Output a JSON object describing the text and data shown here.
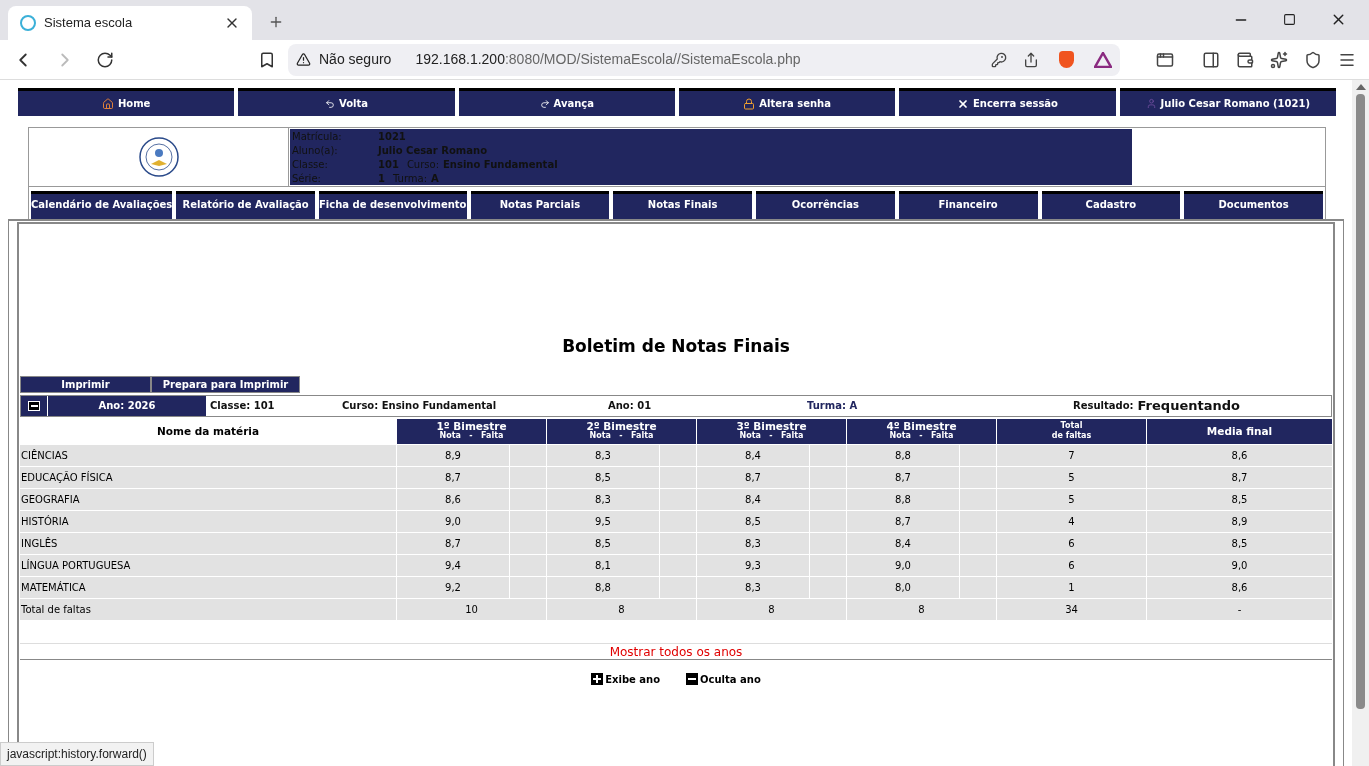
{
  "browser": {
    "tab_title": "Sistema escola",
    "security": "Não seguro",
    "url_host": "192.168.1.200",
    "url_path": ":8080/MOD/SistemaEscola//SistemaEscola.php"
  },
  "top_nav": [
    {
      "label": "Home",
      "kind": "home"
    },
    {
      "label": "Volta",
      "kind": "back"
    },
    {
      "label": "Avança",
      "kind": "forward"
    },
    {
      "label": "Altera senha",
      "kind": "lock"
    },
    {
      "label": "Encerra sessão",
      "kind": "close"
    },
    {
      "label": "Julio Cesar Romano (1021)",
      "kind": "user"
    }
  ],
  "student": [
    {
      "label": "Matrícula:",
      "value": "1021"
    },
    {
      "label": "Aluno(a):",
      "value": "Julio Cesar Romano"
    },
    {
      "label": "Classe:",
      "value": "101",
      "extra_label": "Curso:",
      "extra_value": "Ensino Fundamental"
    },
    {
      "label": "Série:",
      "value": "1",
      "extra_label": "Turma:",
      "extra_value": "A"
    }
  ],
  "tabs": [
    "Calendário de Avaliações",
    "Relatório de Avaliação",
    "Ficha de desenvolvimento",
    "Notas Parciais",
    "Notas Finais",
    "Ocorrências",
    "Financeiro",
    "Cadastro",
    "Documentos"
  ],
  "page_title": "Boletim de Notas Finais",
  "print_buttons": [
    "Imprimir",
    "Prepara para Imprimir"
  ],
  "year_bar": {
    "year": "Ano: 2026",
    "classe": "Classe: 101",
    "curso": "Curso: Ensino Fundamental",
    "ano": "Ano: 01",
    "turma": "Turma: A",
    "result_label": "Resultado:",
    "result_value": "Frequentando"
  },
  "table": {
    "columns": [
      {
        "title": "Nome da matéria",
        "kind": "name"
      },
      {
        "title": "1º Bimestre",
        "subtitle": "Nota   -   Falta",
        "kind": "bim"
      },
      {
        "title": "2º Bimestre",
        "subtitle": "Nota   -   Falta",
        "kind": "bim"
      },
      {
        "title": "3º Bimestre",
        "subtitle": "Nota   -   Falta",
        "kind": "bim"
      },
      {
        "title": "4º Bimestre",
        "subtitle": "Nota   -   Falta",
        "kind": "bim"
      },
      {
        "title": "Total",
        "subtitle": "de faltas",
        "kind": "small"
      },
      {
        "title": "Media final",
        "kind": "plain"
      }
    ],
    "rows": [
      {
        "subject": "CIÊNCIAS",
        "grades": [
          "8,9",
          "8,3",
          "8,4",
          "8,8"
        ],
        "total": "7",
        "media": "8,6"
      },
      {
        "subject": "EDUCAÇÃO FÍSICA",
        "grades": [
          "8,7",
          "8,5",
          "8,7",
          "8,7"
        ],
        "total": "5",
        "media": "8,7"
      },
      {
        "subject": "GEOGRAFIA",
        "grades": [
          "8,6",
          "8,3",
          "8,4",
          "8,8"
        ],
        "total": "5",
        "media": "8,5"
      },
      {
        "subject": "HISTÓRIA",
        "grades": [
          "9,0",
          "9,5",
          "8,5",
          "8,7"
        ],
        "total": "4",
        "media": "8,9"
      },
      {
        "subject": "INGLÊS",
        "grades": [
          "8,7",
          "8,5",
          "8,3",
          "8,4"
        ],
        "total": "6",
        "media": "8,5"
      },
      {
        "subject": "LÍNGUA PORTUGUESA",
        "grades": [
          "9,4",
          "8,1",
          "9,3",
          "9,0"
        ],
        "total": "6",
        "media": "9,0"
      },
      {
        "subject": "MATEMÁTICA",
        "grades": [
          "9,2",
          "8,8",
          "8,3",
          "8,0"
        ],
        "total": "1",
        "media": "8,6"
      }
    ],
    "total_row": {
      "label": "Total de faltas",
      "cells": [
        "10",
        "8",
        "8",
        "8",
        "34",
        "-"
      ]
    }
  },
  "show_all_link": "Mostrar todos os anos",
  "year_toggles": [
    "Exibe ano",
    "Oculta ano"
  ],
  "status_text": "javascript:history.forward()"
}
